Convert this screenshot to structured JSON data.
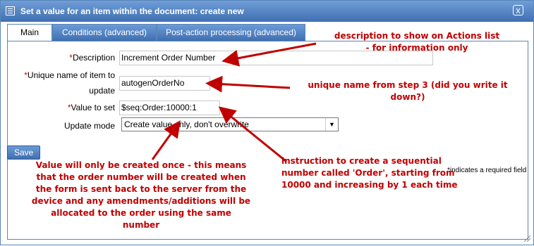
{
  "window": {
    "title": "Set a value for an item within the document: create new",
    "close_label": "x"
  },
  "tabs": [
    {
      "label": "Main"
    },
    {
      "label": "Conditions (advanced)"
    },
    {
      "label": "Post-action processing (advanced)"
    }
  ],
  "form": {
    "required_marker": "*",
    "description": {
      "label": "Description",
      "value": "Increment Order Number"
    },
    "unique_name": {
      "label_line1": "Unique name of item to",
      "label_line2": "update",
      "value": "autogenOrderNo"
    },
    "value_to_set": {
      "label": "Value to set",
      "value": "$seq:Order:10000:1"
    },
    "update_mode": {
      "label": "Update mode",
      "selected": "Create value only, don't overwrite"
    },
    "save_label": "Save",
    "required_note": "*indicates a required field"
  },
  "annotations": {
    "description_note": [
      "description to show on Actions list",
      "- for information only"
    ],
    "unique_name_note": [
      "unique name from step 3 (did you write it",
      "down?)"
    ],
    "value_note": [
      "Value will only be created once - this means",
      "that the order number will be created when",
      "the form is sent back to the server from the",
      "device and any amendments/additions will be",
      "allocated to the order using the same",
      "number"
    ],
    "sequence_note": [
      "instruction to create a sequential",
      "number called 'Order', starting from",
      "10000 and increasing by 1 each time"
    ],
    "color": "#c00000"
  }
}
